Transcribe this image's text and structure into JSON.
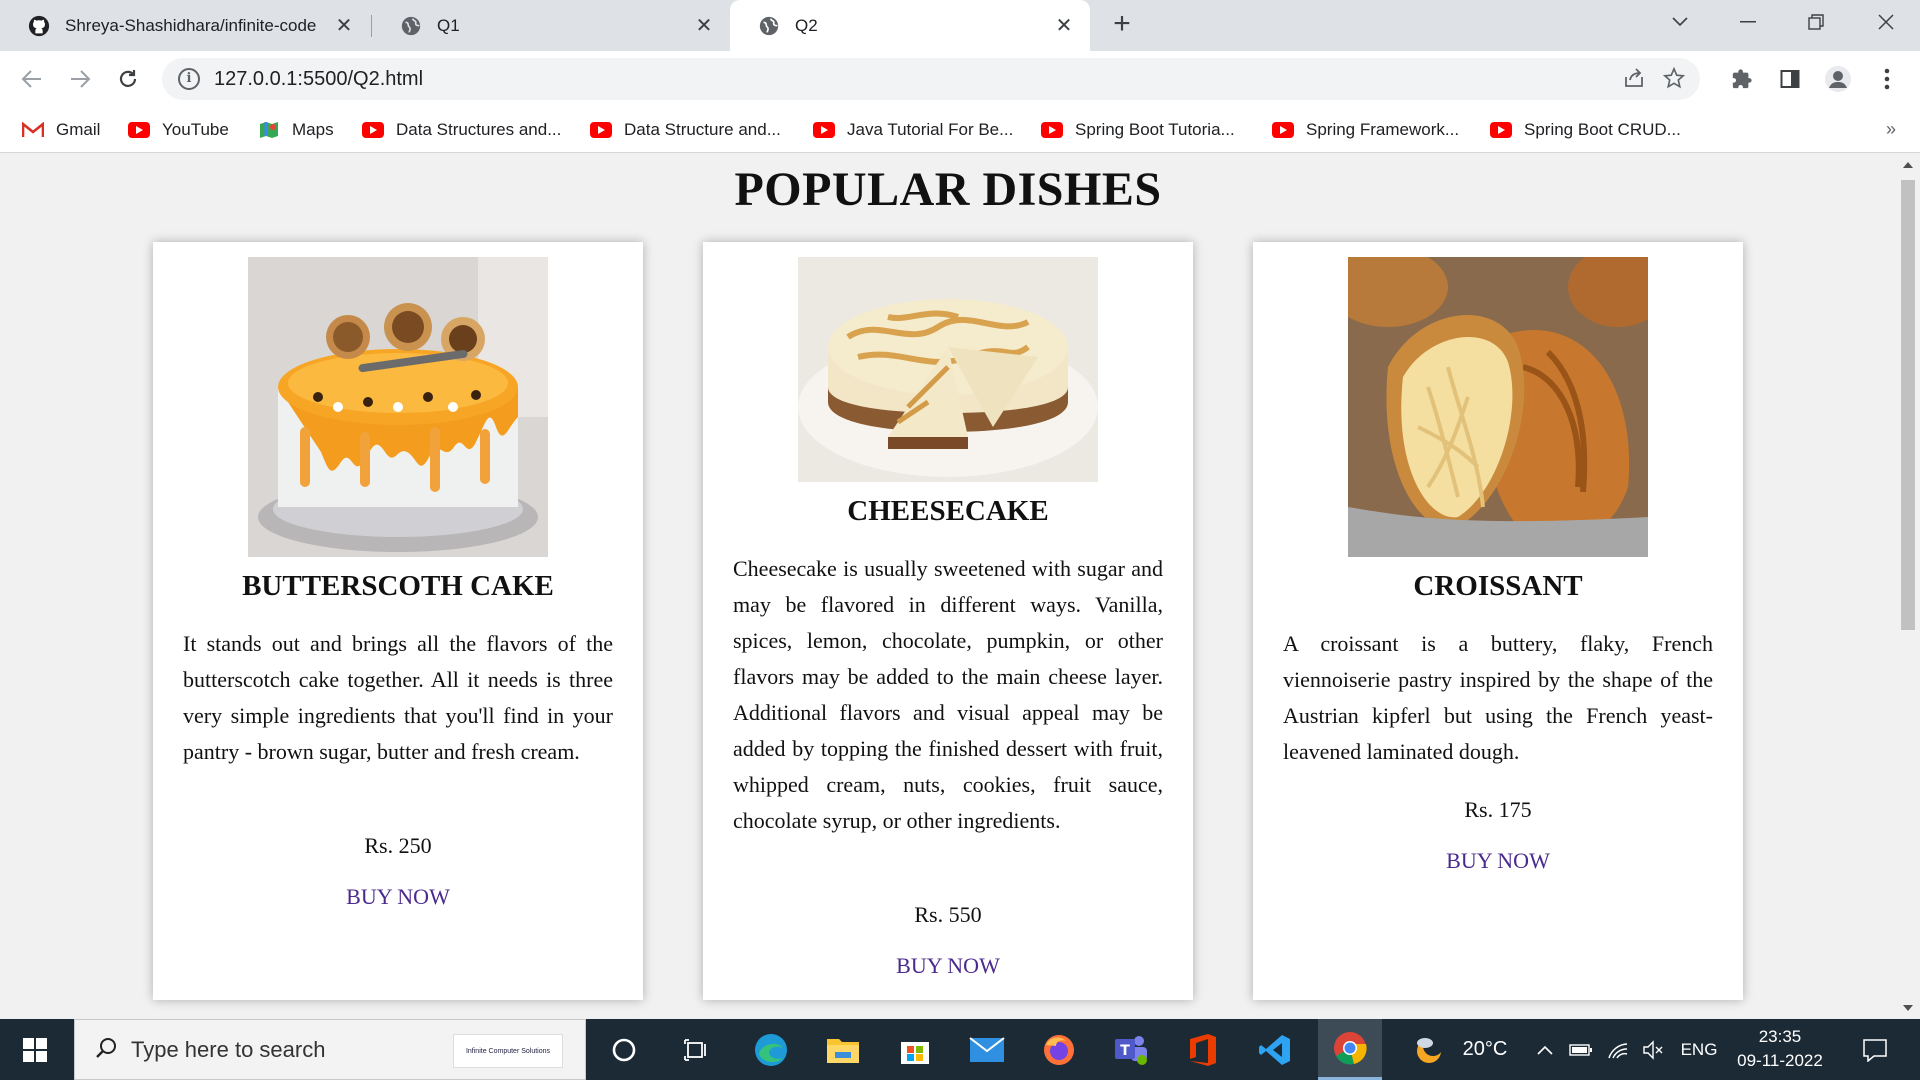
{
  "browser": {
    "tabs": [
      {
        "title": "Shreya-Shashidhara/infinite-code",
        "favicon": "github-icon",
        "active": false
      },
      {
        "title": "Q1",
        "favicon": "globe-icon",
        "active": false
      },
      {
        "title": "Q2",
        "favicon": "globe-icon",
        "active": true
      }
    ],
    "new_tab_label": "+",
    "url": "127.0.0.1:5500/Q2.html",
    "bookmarks": [
      {
        "label": "Gmail",
        "icon": "gmail-icon"
      },
      {
        "label": "YouTube",
        "icon": "youtube-icon"
      },
      {
        "label": "Maps",
        "icon": "maps-icon"
      },
      {
        "label": "Data Structures and...",
        "icon": "youtube-icon"
      },
      {
        "label": "Data Structure and...",
        "icon": "youtube-icon"
      },
      {
        "label": "Java Tutorial For Be...",
        "icon": "youtube-icon"
      },
      {
        "label": "Spring Boot Tutoria...",
        "icon": "youtube-icon"
      },
      {
        "label": "Spring Framework...",
        "icon": "youtube-icon"
      },
      {
        "label": "Spring Boot CRUD...",
        "icon": "youtube-icon"
      }
    ],
    "bookmarks_more": "»"
  },
  "page": {
    "heading": "POPULAR DISHES",
    "dishes": [
      {
        "name": "BUTTERSCOTH CAKE",
        "description": "It stands out and brings all the flavors of the butterscotch cake together. All it needs is three very simple ingredients that you'll find in your pantry - brown sugar, butter and fresh cream.",
        "price": "Rs. 250",
        "buy_label": "BUY NOW",
        "image": "butterscotch-cake-image"
      },
      {
        "name": "CHEESECAKE",
        "description": "Cheesecake is usually sweetened with sugar and may be flavored in different ways. Vanilla, spices, lemon, chocolate, pumpkin, or other flavors may be added to the main cheese layer. Additional flavors and visual appeal may be added by topping the finished dessert with fruit, whipped cream, nuts, cookies, fruit sauce, chocolate syrup, or other ingredients.",
        "price": "Rs. 550",
        "buy_label": "BUY NOW",
        "image": "cheesecake-image"
      },
      {
        "name": "CROISSANT",
        "description": "A croissant is a buttery, flaky, French viennoiserie pastry inspired by the shape of the Austrian kipferl but using the French yeast-leavened laminated dough.",
        "price": "Rs. 175",
        "buy_label": "BUY NOW",
        "image": "croissant-image"
      }
    ],
    "link_color": "#4b2a8e"
  },
  "taskbar": {
    "search_placeholder": "Type here to search",
    "promo_text": "Infinite Computer Solutions",
    "weather": "20°C",
    "language": "ENG",
    "time": "23:35",
    "date": "09-11-2022"
  }
}
